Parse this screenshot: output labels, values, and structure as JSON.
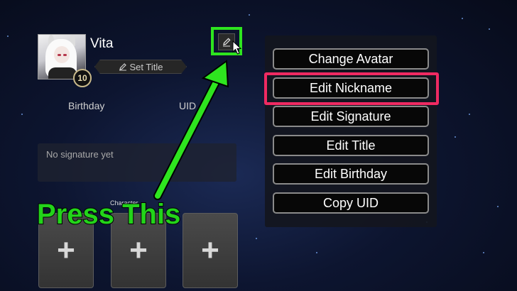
{
  "profile": {
    "name": "Vita",
    "level": "10",
    "set_title_label": "Set Title",
    "birthday_label": "Birthday",
    "uid_label": "UID",
    "signature_placeholder": "No signature yet",
    "character_label": "Character",
    "slot_symbol": "+"
  },
  "annotation": {
    "caption": "Press This",
    "arrow_color": "#2ee51f",
    "highlight_color": "#ef2a62"
  },
  "menu": {
    "items": [
      {
        "label": "Change Avatar"
      },
      {
        "label": "Edit Nickname"
      },
      {
        "label": "Edit Signature"
      },
      {
        "label": "Edit Title"
      },
      {
        "label": "Edit Birthday"
      },
      {
        "label": "Copy UID"
      }
    ]
  },
  "icons": {
    "edit": "pencil-icon",
    "set_title": "pencil-icon",
    "slot": "plus-icon",
    "cursor": "mouse-cursor-icon"
  }
}
